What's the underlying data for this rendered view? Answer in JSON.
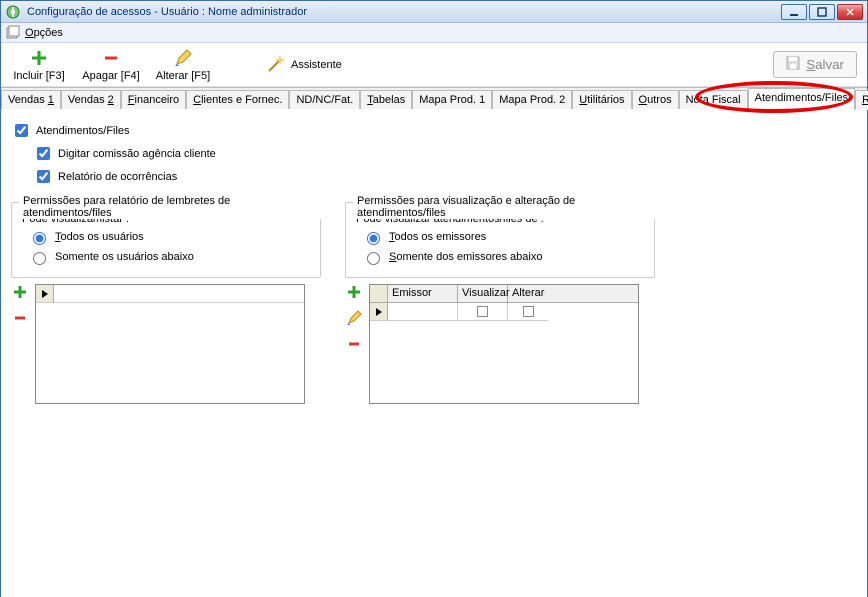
{
  "window": {
    "title": "Configuração de acessos - Usuário : Nome administrador"
  },
  "menu": {
    "options": "Opções"
  },
  "toolbar": {
    "incluir": "Incluir [F3]",
    "apagar": "Apagar [F4]",
    "alterar": "Alterar [F5]",
    "assistente": "Assistente",
    "salvar": "Salvar"
  },
  "tabs": [
    {
      "label": "Vendas 1"
    },
    {
      "label": "Vendas 2"
    },
    {
      "label": "Financeiro"
    },
    {
      "label": "Clientes e Fornec."
    },
    {
      "label": "ND/NC/Fat."
    },
    {
      "label": "Tabelas"
    },
    {
      "label": "Mapa Prod. 1"
    },
    {
      "label": "Mapa Prod. 2"
    },
    {
      "label": "Utilitários"
    },
    {
      "label": "Outros"
    },
    {
      "label": "Nota Fiscal"
    },
    {
      "label": "Atendimentos/Files",
      "selected": true
    },
    {
      "label": "Reemb."
    }
  ],
  "content": {
    "main_chk": "Atendimentos/Files",
    "sub1": "Digitar comissão agência cliente",
    "sub2": "Relatório de ocorrências",
    "left": {
      "group": "Permissões para relatório de lembretes de atendimentos/files",
      "sub": "Pode visualizar/listar :",
      "opt1": "Todos os usuários",
      "opt2": "Somente os usuários abaixo"
    },
    "right": {
      "group": "Permissões para visualização e alteração de atendimentos/files",
      "sub": "Pode visualizar atendimentos/files de :",
      "opt1": "Todos os emissores",
      "opt2": "Somente dos emissores abaixo",
      "cols": {
        "c1": "Emissor",
        "c2": "Visualizar",
        "c3": "Alterar"
      }
    }
  }
}
